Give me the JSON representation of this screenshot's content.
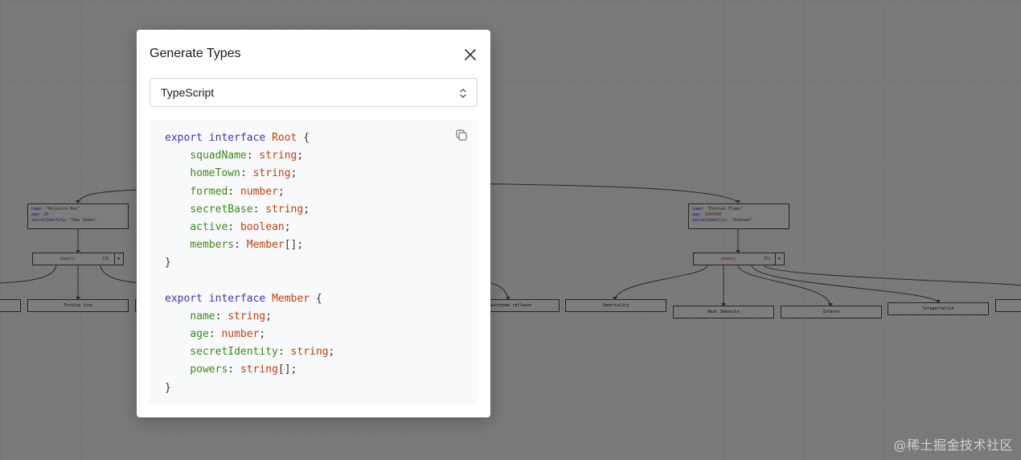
{
  "modal": {
    "title": "Generate Types",
    "language": {
      "selected": "TypeScript"
    },
    "interfaces": [
      {
        "keyword": "export interface",
        "name": "Root",
        "fields": [
          {
            "name": "squadName",
            "type": "string"
          },
          {
            "name": "homeTown",
            "type": "string"
          },
          {
            "name": "formed",
            "type": "number"
          },
          {
            "name": "secretBase",
            "type": "string"
          },
          {
            "name": "active",
            "type": "boolean"
          },
          {
            "name": "members",
            "type": "Member[]"
          }
        ]
      },
      {
        "keyword": "export interface",
        "name": "Member",
        "fields": [
          {
            "name": "name",
            "type": "string"
          },
          {
            "name": "age",
            "type": "number"
          },
          {
            "name": "secretIdentity",
            "type": "string"
          },
          {
            "name": "powers",
            "type": "string[]"
          }
        ]
      }
    ],
    "icons": {
      "close": "close-icon",
      "copy": "copy-icon",
      "select": "chevron-up-down-icon"
    }
  },
  "graph": {
    "member_left": {
      "name": "\"Molecule Man\"",
      "age": "29",
      "secretIdentity": "\"Dan Jukes\""
    },
    "member_right": {
      "name": "\"Eternal Flame\"",
      "age": "1000000",
      "secretIdentity": "\"Unknown\""
    },
    "powers_left": {
      "label": "powers",
      "count": "(3)"
    },
    "powers_right": {
      "label": "powers",
      "count": "(5)"
    },
    "leaves": [
      "Turning tiny",
      "Superhuman reflexes",
      "Immortality",
      "Heat Immunity",
      "Inferno",
      "Teleportation"
    ]
  },
  "watermark": "@稀土掘金技术社区"
}
